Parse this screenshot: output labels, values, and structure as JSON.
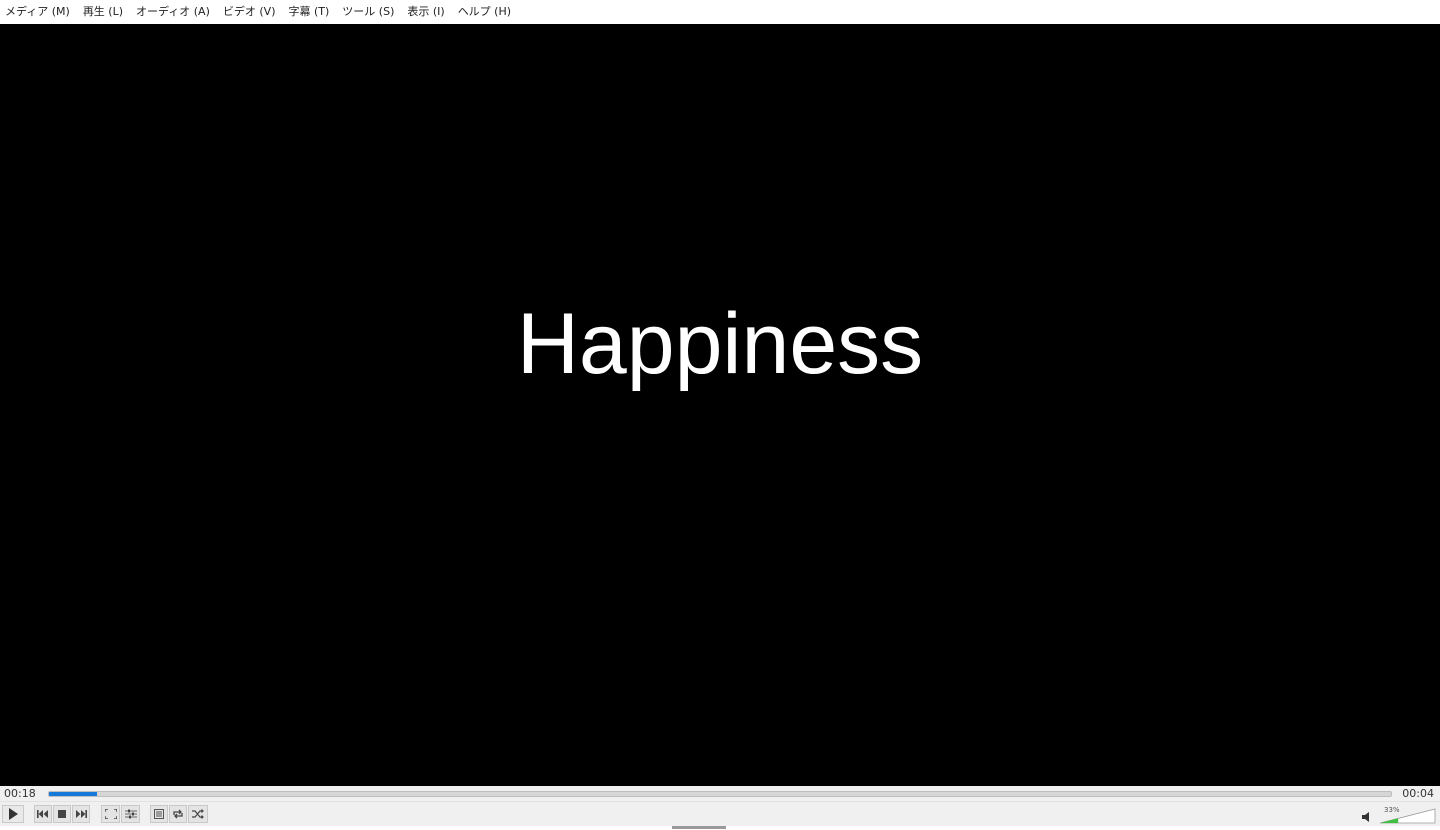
{
  "menu": {
    "items": [
      {
        "label": "メディア (M)"
      },
      {
        "label": "再生 (L)"
      },
      {
        "label": "オーディオ (A)"
      },
      {
        "label": "ビデオ (V)"
      },
      {
        "label": "字幕 (T)"
      },
      {
        "label": "ツール (S)"
      },
      {
        "label": "表示 (I)"
      },
      {
        "label": "ヘルプ (H)"
      }
    ]
  },
  "video": {
    "subtitle_text": "Happiness"
  },
  "seek": {
    "elapsed": "00:18",
    "total": "00:04",
    "progress_fraction": 0.036
  },
  "controls": {
    "buttons": [
      {
        "name": "play-button",
        "icon": "play-icon"
      },
      {
        "name": "previous-button",
        "icon": "skip-back-icon"
      },
      {
        "name": "stop-button",
        "icon": "stop-icon"
      },
      {
        "name": "next-button",
        "icon": "skip-forward-icon"
      },
      {
        "name": "fullscreen-button",
        "icon": "fullscreen-icon"
      },
      {
        "name": "extended-settings-button",
        "icon": "sliders-icon"
      },
      {
        "name": "playlist-button",
        "icon": "playlist-icon"
      },
      {
        "name": "loop-button",
        "icon": "loop-icon"
      },
      {
        "name": "random-button",
        "icon": "shuffle-icon"
      }
    ],
    "volume": {
      "label": "33%",
      "level_fraction": 0.33,
      "accent": "#3fbf3f"
    }
  },
  "colors": {
    "seek_accent": "#1479d9",
    "video_background": "#000000",
    "subtitle": "#ffffff"
  }
}
